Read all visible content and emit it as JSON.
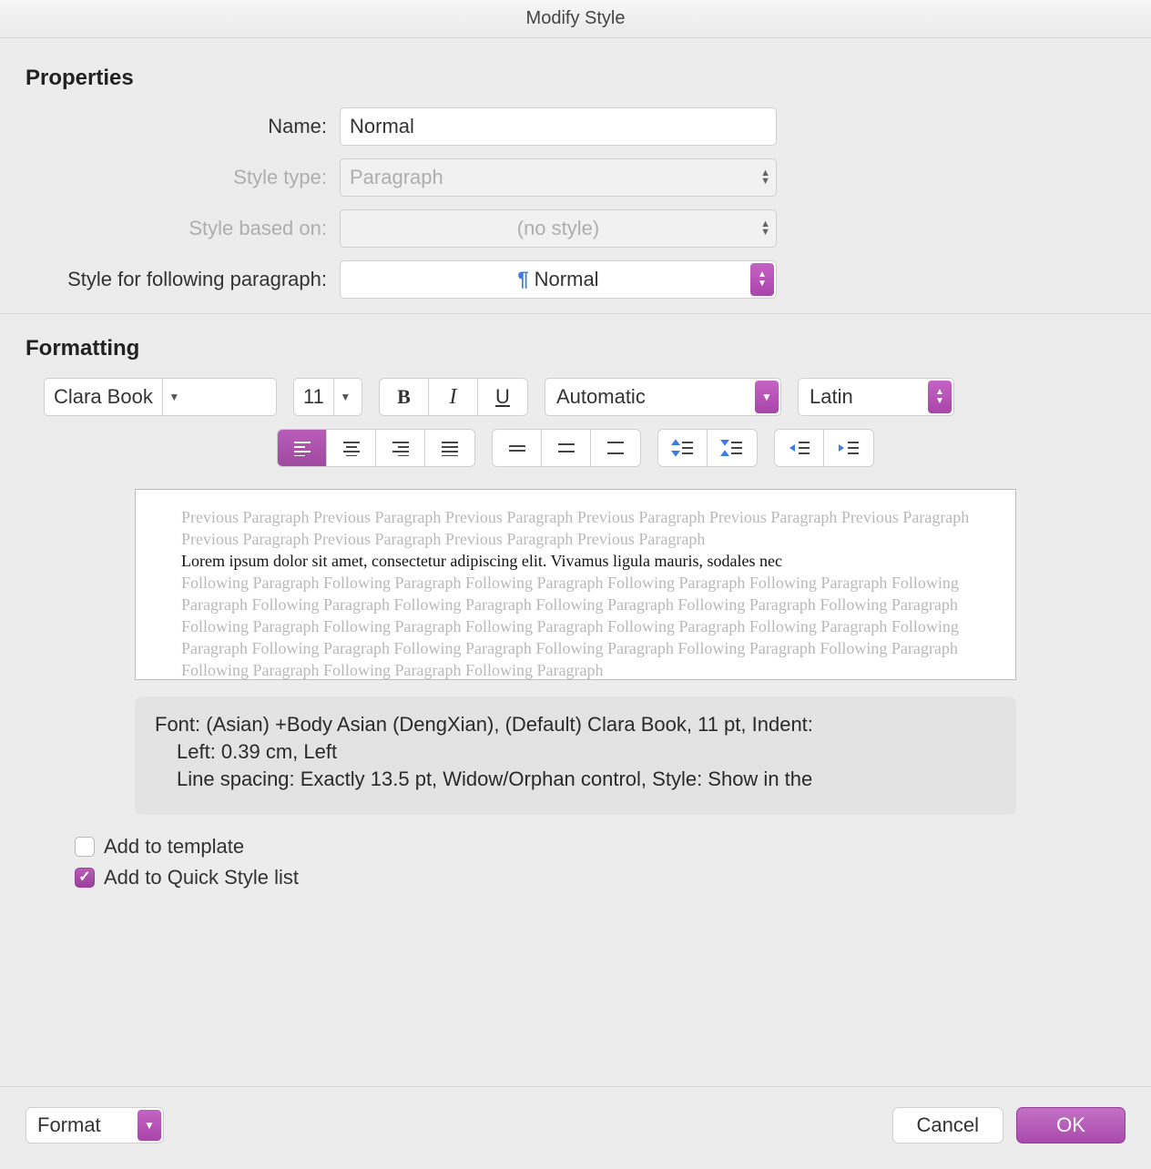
{
  "window": {
    "title": "Modify Style"
  },
  "sections": {
    "properties_heading": "Properties",
    "formatting_heading": "Formatting"
  },
  "properties": {
    "name": {
      "label": "Name:",
      "value": "Normal"
    },
    "style_type": {
      "label": "Style type:",
      "value": "Paragraph"
    },
    "based_on": {
      "label": "Style based on:",
      "value": "(no style)"
    },
    "following": {
      "label": "Style for following paragraph:",
      "value": "Normal"
    }
  },
  "formatting": {
    "font": "Clara Book",
    "size": "11",
    "color": "Automatic",
    "script": "Latin"
  },
  "preview": {
    "ghost_prev": "Previous Paragraph Previous Paragraph Previous Paragraph Previous Paragraph Previous Paragraph Previous Paragraph Previous Paragraph Previous Paragraph Previous Paragraph Previous Paragraph",
    "sample": "Lorem ipsum dolor sit amet, consectetur adipiscing elit. Vivamus ligula mauris, sodales nec",
    "ghost_next": "Following Paragraph Following Paragraph Following Paragraph Following Paragraph Following Paragraph Following Paragraph Following Paragraph Following Paragraph Following Paragraph Following Paragraph Following Paragraph Following Paragraph Following Paragraph Following Paragraph Following Paragraph Following Paragraph Following Paragraph Following Paragraph Following Paragraph Following Paragraph Following Paragraph Following Paragraph Following Paragraph Following Paragraph Following Paragraph"
  },
  "description": {
    "line1": "Font: (Asian) +Body Asian (DengXian), (Default) Clara Book, 11 pt, Indent:",
    "line2": "Left:  0.39 cm, Left",
    "line3": "Line spacing:  Exactly 13.5 pt, Widow/Orphan control, Style: Show in the"
  },
  "checks": {
    "add_template": {
      "label": "Add to template",
      "checked": false
    },
    "add_quick": {
      "label": "Add to Quick Style list",
      "checked": true
    }
  },
  "footer": {
    "format_menu": "Format",
    "cancel": "Cancel",
    "ok": "OK"
  }
}
